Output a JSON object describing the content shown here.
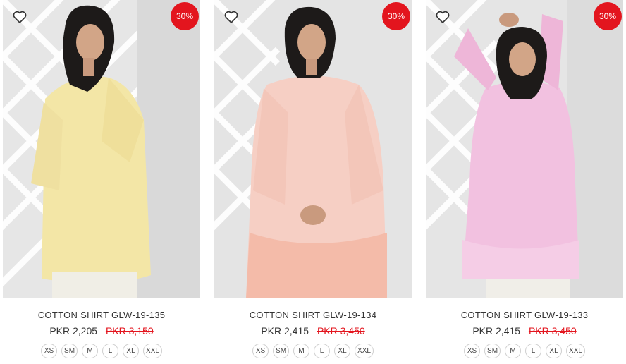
{
  "products": [
    {
      "name": "COTTON SHIRT GLW-19-135",
      "price": "PKR 2,205",
      "original_price": "PKR 3,150",
      "discount": "30%",
      "garment_color": "#f3e6a6",
      "sizes": [
        "XS",
        "SM",
        "M",
        "L",
        "XL",
        "XXL"
      ]
    },
    {
      "name": "COTTON SHIRT GLW-19-134",
      "price": "PKR 2,415",
      "original_price": "PKR 3,450",
      "discount": "30%",
      "garment_color": "#f6cfc4",
      "sizes": [
        "XS",
        "SM",
        "M",
        "L",
        "XL",
        "XXL"
      ]
    },
    {
      "name": "COTTON SHIRT GLW-19-133",
      "price": "PKR 2,415",
      "original_price": "PKR 3,450",
      "discount": "30%",
      "garment_color": "#f2c1e0",
      "sizes": [
        "XS",
        "SM",
        "M",
        "L",
        "XL",
        "XXL"
      ]
    }
  ],
  "colors": {
    "badge": "#e3151e",
    "sale_price_strike": "#e3151e",
    "text": "#333333"
  },
  "icons": {
    "wishlist": "heart-outline-icon"
  }
}
